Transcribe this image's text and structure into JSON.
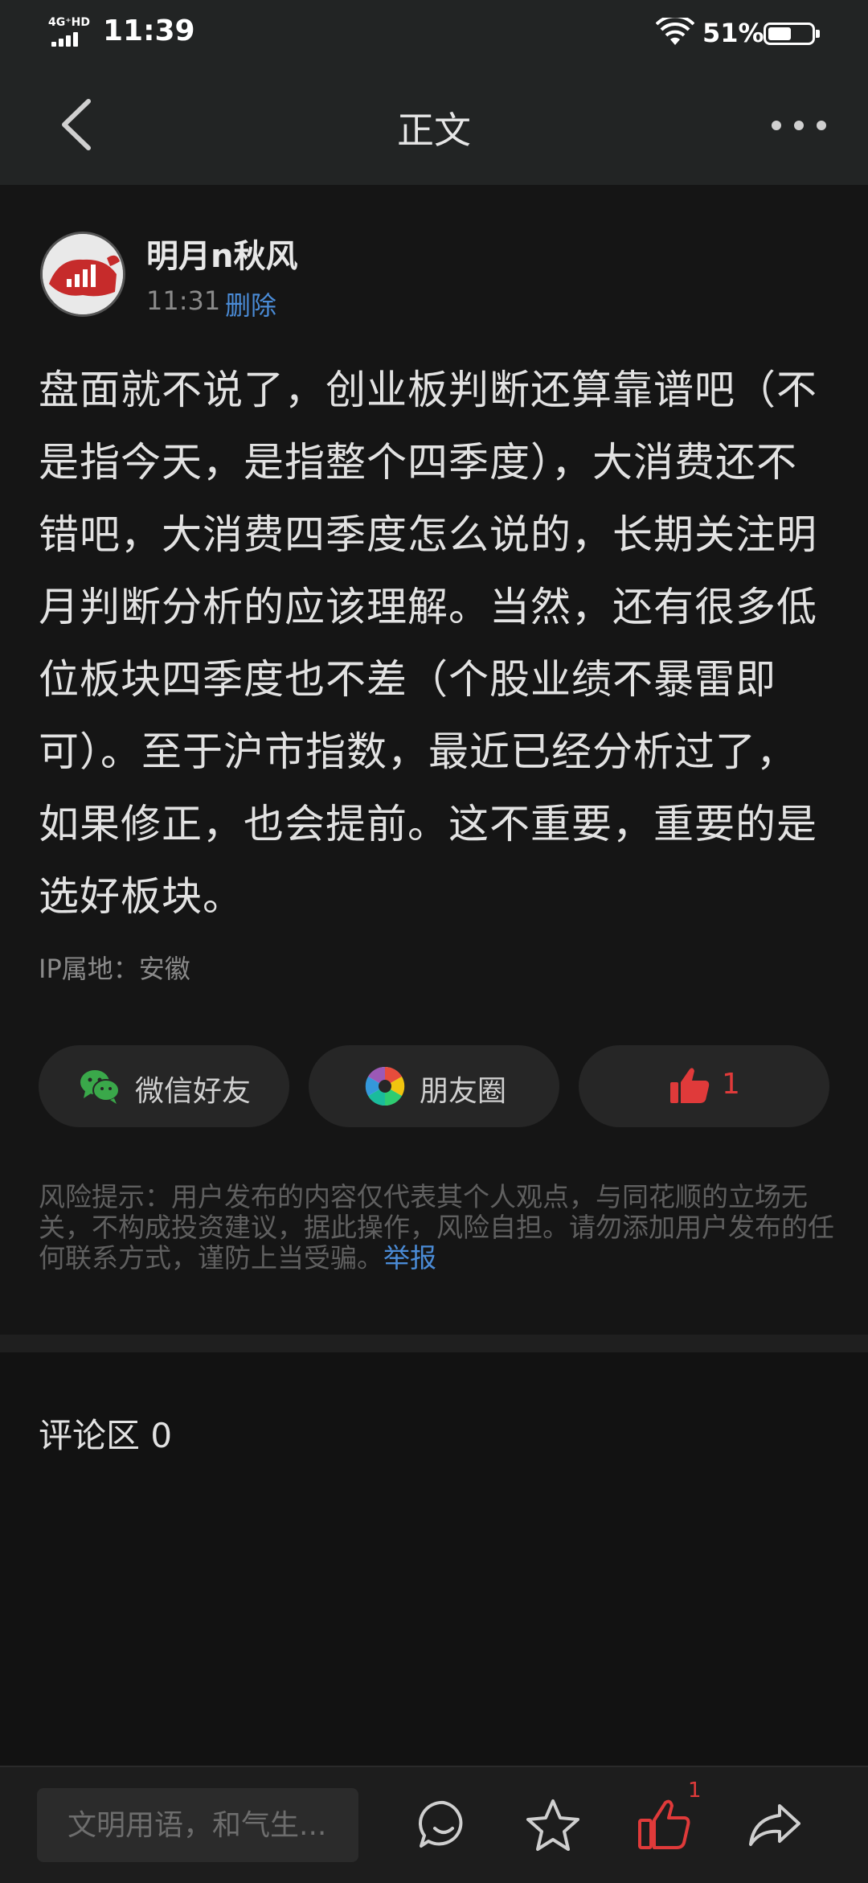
{
  "status_bar": {
    "network": "4G⁺HD",
    "time": "11:39",
    "battery_percent": "51%",
    "battery_level": 0.51
  },
  "nav": {
    "title": "正文"
  },
  "post": {
    "author": "明月n秋风",
    "time": "11:31",
    "delete_label": "删除",
    "content": "盘面就不说了，创业板判断还算靠谱吧（不是指今天，是指整个四季度），大消费还不错吧，大消费四季度怎么说的，长期关注明月判断分析的应该理解。当然，还有很多低位板块四季度也不差（个股业绩不暴雷即可）。至于沪市指数，最近已经分析过了，如果修正，也会提前。这不重要，重要的是选好板块。",
    "ip_location": "IP属地：安徽"
  },
  "share": {
    "wechat_label": "微信好友",
    "moments_label": "朋友圈",
    "like_count": "1"
  },
  "risk_notice": {
    "text": "风险提示：用户发布的内容仅代表其个人观点，与同花顺的立场无关，不构成投资建议，据此操作，风险自担。请勿添加用户发布的任何联系方式，谨防上当受骗。",
    "report_label": "举报"
  },
  "comments": {
    "title": "评论区 0"
  },
  "bottom_bar": {
    "input_placeholder": "文明用语，和气生...",
    "like_badge": "1"
  },
  "colors": {
    "background": "#151515",
    "header": "#222424",
    "accent_blue": "#4a8bd6",
    "like_red": "#e03a3a"
  }
}
